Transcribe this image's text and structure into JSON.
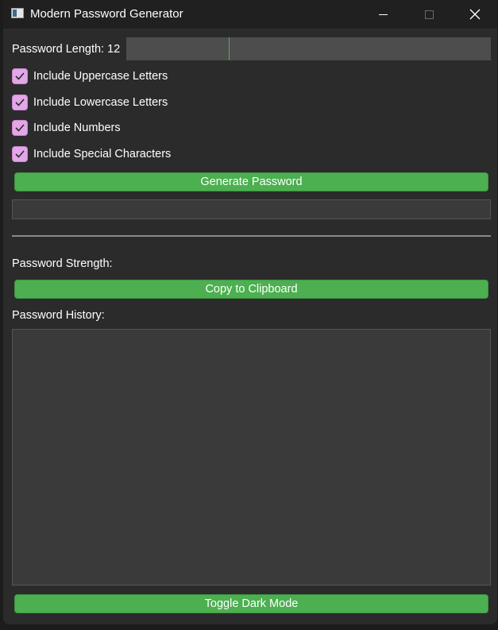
{
  "window": {
    "title": "Modern Password Generator"
  },
  "controls": {
    "password_length_label": "Password Length: 12",
    "password_length_value": 12,
    "password_length_fraction": 0.28
  },
  "options": [
    {
      "label": "Include Uppercase Letters",
      "checked": true
    },
    {
      "label": "Include Lowercase Letters",
      "checked": true
    },
    {
      "label": "Include Numbers",
      "checked": true
    },
    {
      "label": "Include Special Characters",
      "checked": true
    }
  ],
  "buttons": {
    "generate": "Generate Password",
    "copy": "Copy to Clipboard",
    "toggle_dark": "Toggle Dark Mode"
  },
  "output": {
    "password": ""
  },
  "strength": {
    "label": "Password Strength:"
  },
  "history": {
    "label": "Password History:",
    "items": []
  },
  "colors": {
    "accent": "#4caf50",
    "checkbox": "#e3a6e8",
    "background": "#2b2b2b",
    "titlebar": "#202020"
  }
}
